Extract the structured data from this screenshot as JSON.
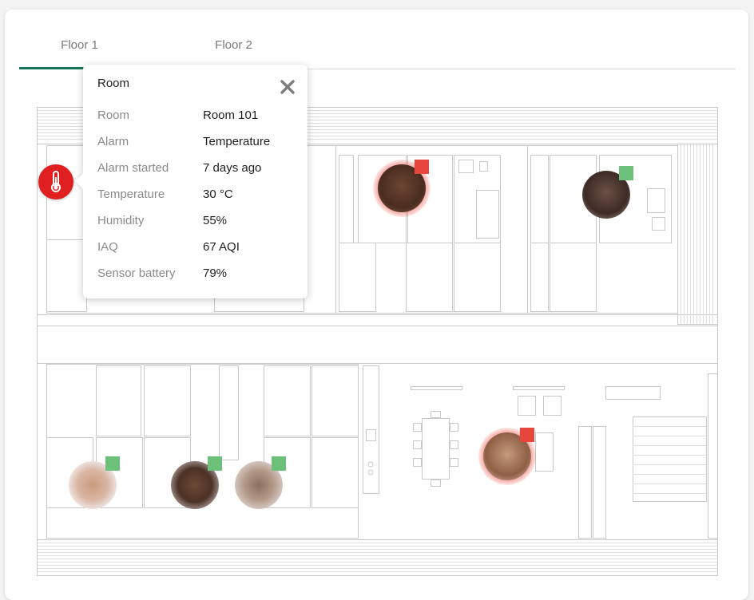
{
  "tabs": [
    {
      "label": "Floor 1",
      "active": true
    },
    {
      "label": "Floor 2",
      "active": false
    }
  ],
  "alarm_marker": {
    "icon": "thermometer-icon",
    "color": "#e02020"
  },
  "popup": {
    "title": "Room",
    "rows": [
      {
        "label": "Room",
        "value": "Room 101"
      },
      {
        "label": "Alarm",
        "value": "Temperature"
      },
      {
        "label": "Alarm started",
        "value": "7 days ago"
      },
      {
        "label": "Temperature",
        "value": "30 °C"
      },
      {
        "label": "Humidity",
        "value": "55%"
      },
      {
        "label": "IAQ",
        "value": "67 AQI"
      },
      {
        "label": "Sensor battery",
        "value": "79%"
      }
    ]
  },
  "occupants": [
    {
      "status": "alarm",
      "color": "#e8463c",
      "skin": "#6b4533"
    },
    {
      "status": "ok",
      "color": "#6cc07a",
      "skin": "#6a5146"
    },
    {
      "status": "alarm",
      "color": "#e8463c",
      "skin": "#b5856e"
    },
    {
      "status": "ok",
      "color": "#6cc07a",
      "skin": "#c99a7d"
    },
    {
      "status": "ok",
      "color": "#6cc07a",
      "skin": "#6d4a37"
    },
    {
      "status": "ok",
      "color": "#6cc07a",
      "skin": "#8a7060"
    }
  ],
  "accent_color": "#16745a"
}
